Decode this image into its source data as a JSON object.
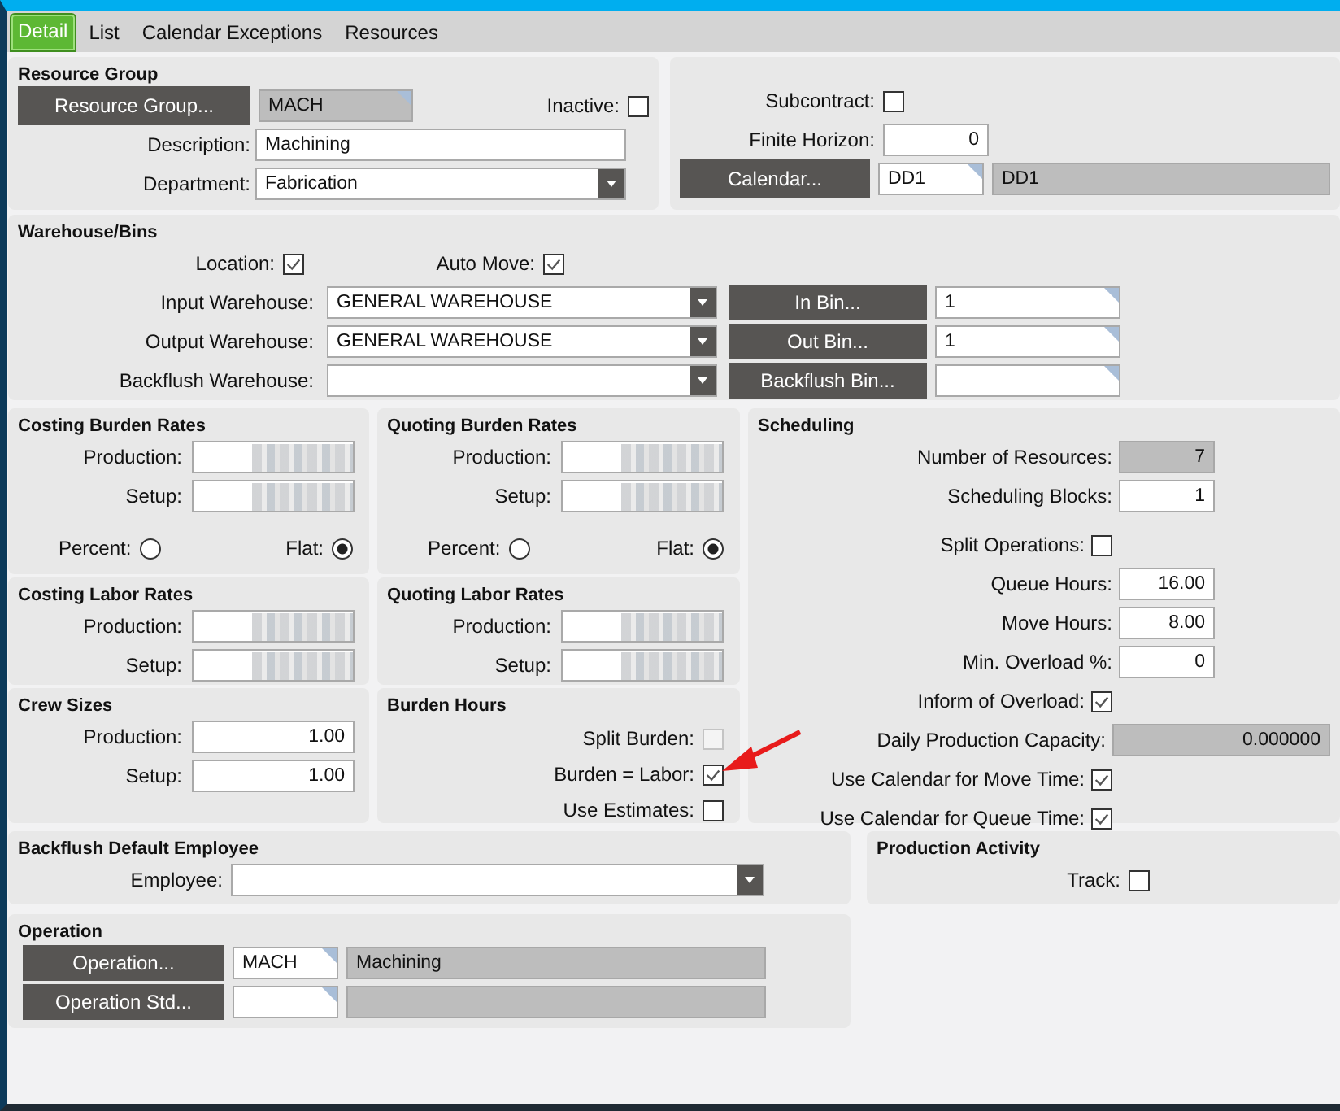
{
  "tabs": [
    {
      "label": "Detail",
      "selected": true
    },
    {
      "label": "List",
      "selected": false
    },
    {
      "label": "Calendar Exceptions",
      "selected": false
    },
    {
      "label": "Resources",
      "selected": false
    }
  ],
  "resource_group": {
    "title": "Resource Group",
    "button": "Resource Group...",
    "code": "MACH",
    "inactive": {
      "label": "Inactive:",
      "checked": false
    },
    "description": {
      "label": "Description:",
      "value": "Machining"
    },
    "department": {
      "label": "Department:",
      "value": "Fabrication"
    }
  },
  "general": {
    "subcontract": {
      "label": "Subcontract:",
      "checked": false
    },
    "finite_horizon": {
      "label": "Finite Horizon:",
      "value": "0"
    },
    "calendar": {
      "button": "Calendar...",
      "code": "DD1",
      "description": "DD1"
    }
  },
  "warehouse_bins": {
    "title": "Warehouse/Bins",
    "location": {
      "label": "Location:",
      "checked": true
    },
    "auto_move": {
      "label": "Auto Move:",
      "checked": true
    },
    "rows": [
      {
        "label": "Input Warehouse:",
        "value": "GENERAL WAREHOUSE",
        "button": "In Bin...",
        "bin": "1"
      },
      {
        "label": "Output Warehouse:",
        "value": "GENERAL WAREHOUSE",
        "button": "Out Bin...",
        "bin": "1"
      },
      {
        "label": "Backflush Warehouse:",
        "button": "Backflush Bin..."
      }
    ]
  },
  "costing_burden_rates": {
    "title": "Costing Burden Rates",
    "fields": [
      {
        "label": "Production:",
        "obscured": true
      },
      {
        "label": "Setup:",
        "obscured": true
      }
    ],
    "options": [
      {
        "label": "Percent:",
        "selected": false
      },
      {
        "label": "Flat:",
        "selected": true
      }
    ]
  },
  "quoting_burden_rates": {
    "title": "Quoting Burden Rates",
    "fields": [
      {
        "label": "Production:",
        "obscured": true
      },
      {
        "label": "Setup:",
        "obscured": true
      }
    ],
    "options": [
      {
        "label": "Percent:",
        "selected": false
      },
      {
        "label": "Flat:",
        "selected": true
      }
    ]
  },
  "costing_labor_rates": {
    "title": "Costing Labor Rates",
    "fields": [
      {
        "label": "Production:",
        "obscured": true
      },
      {
        "label": "Setup:",
        "obscured": true
      }
    ]
  },
  "quoting_labor_rates": {
    "title": "Quoting Labor Rates",
    "fields": [
      {
        "label": "Production:",
        "obscured": true
      },
      {
        "label": "Setup:",
        "obscured": true
      }
    ]
  },
  "crew_sizes": {
    "title": "Crew Sizes",
    "fields": [
      {
        "label": "Production:",
        "value": "1.00",
        "obscured": false
      },
      {
        "label": "Setup:",
        "value": "1.00",
        "obscured": false
      }
    ]
  },
  "burden_hours": {
    "title": "Burden Hours",
    "options": [
      {
        "label": "Split Burden:",
        "checked": false,
        "disabled": true
      },
      {
        "label": "Burden = Labor:",
        "checked": true,
        "disabled": false
      },
      {
        "label": "Use Estimates:",
        "checked": false,
        "disabled": false
      }
    ]
  },
  "scheduling": {
    "title": "Scheduling",
    "rows": [
      {
        "kind": "field",
        "label": "Number of Resources:",
        "value": "7",
        "readonly": true
      },
      {
        "kind": "field",
        "label": "Scheduling Blocks:",
        "value": "1",
        "readonly": false
      },
      {
        "kind": "check",
        "label": "Split Operations:",
        "checked": false
      },
      {
        "kind": "field",
        "label": "Queue Hours:",
        "value": "16.00",
        "readonly": false
      },
      {
        "kind": "field",
        "label": "Move Hours:",
        "value": "8.00",
        "readonly": false
      },
      {
        "kind": "field",
        "label": "Min. Overload %:",
        "value": "0",
        "readonly": false
      },
      {
        "kind": "check",
        "label": "Inform of Overload:",
        "checked": true
      },
      {
        "kind": "wide",
        "label": "Daily Production Capacity:",
        "value": "0.000000",
        "readonly": true
      },
      {
        "kind": "check",
        "label": "Use Calendar for Move Time:",
        "checked": true
      },
      {
        "kind": "check",
        "label": "Use Calendar for Queue Time:",
        "checked": true
      }
    ]
  },
  "backflush_employee": {
    "title": "Backflush Default Employee",
    "employee": {
      "label": "Employee:"
    }
  },
  "production_activity": {
    "title": "Production Activity",
    "track": {
      "label": "Track:",
      "checked": false
    }
  },
  "operation": {
    "title": "Operation",
    "rows": [
      {
        "button": "Operation...",
        "code": "MACH",
        "description": "Machining"
      },
      {
        "button": "Operation Std..."
      }
    ]
  }
}
